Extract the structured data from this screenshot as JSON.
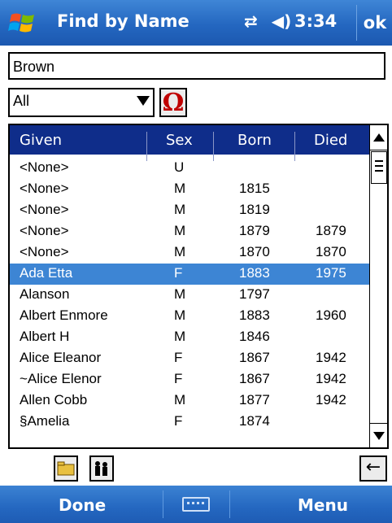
{
  "titlebar": {
    "title": "Find by Name",
    "time": "3:34",
    "ok": "ok",
    "icons": [
      "windows-logo-icon",
      "connectivity-icon",
      "volume-icon"
    ]
  },
  "search": {
    "value": "Brown"
  },
  "filter": {
    "selected": "All"
  },
  "omega_button": {
    "label": "Ω"
  },
  "table": {
    "headers": {
      "given": "Given",
      "sex": "Sex",
      "born": "Born",
      "died": "Died"
    },
    "rows": [
      {
        "given": "<None>",
        "sex": "U",
        "born": "",
        "died": ""
      },
      {
        "given": "<None>",
        "sex": "M",
        "born": "1815",
        "died": ""
      },
      {
        "given": "<None>",
        "sex": "M",
        "born": "1819",
        "died": ""
      },
      {
        "given": "<None>",
        "sex": "M",
        "born": "1879",
        "died": "1879"
      },
      {
        "given": "<None>",
        "sex": "M",
        "born": "1870",
        "died": "1870"
      },
      {
        "given": "Ada Etta",
        "sex": "F",
        "born": "1883",
        "died": "1975"
      },
      {
        "given": "Alanson",
        "sex": "M",
        "born": "1797",
        "died": ""
      },
      {
        "given": "Albert Enmore",
        "sex": "M",
        "born": "1883",
        "died": "1960"
      },
      {
        "given": "Albert H",
        "sex": "M",
        "born": "1846",
        "died": ""
      },
      {
        "given": "Alice Eleanor",
        "sex": "F",
        "born": "1867",
        "died": "1942"
      },
      {
        "given": "~Alice Elenor",
        "sex": "F",
        "born": "1867",
        "died": "1942"
      },
      {
        "given": "Allen Cobb",
        "sex": "M",
        "born": "1877",
        "died": "1942"
      },
      {
        "given": "§Amelia",
        "sex": "F",
        "born": "1874",
        "died": ""
      }
    ],
    "selected_index": 5
  },
  "toolbar": {
    "icons": [
      "open-folder-icon",
      "family-icon",
      "back-arrow-icon"
    ],
    "back_glyph": "←"
  },
  "menubar": {
    "left": "Done",
    "right": "Menu"
  },
  "colors": {
    "titlebar": "#2467c0",
    "header": "#0f2d8a",
    "selection": "#3d85d4",
    "omega": "#c00000"
  }
}
